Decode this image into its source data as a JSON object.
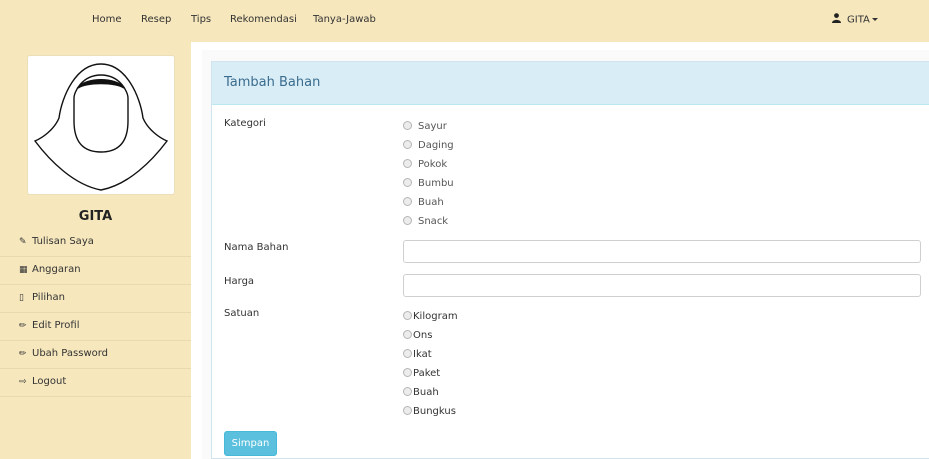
{
  "nav": {
    "links": [
      "Home",
      "Resep",
      "Tips",
      "Rekomendasi",
      "Tanya-Jawab"
    ],
    "user": "GITA"
  },
  "sidebar": {
    "name": "GITA",
    "menu": [
      {
        "label": "Tulisan Saya",
        "icon": "edit-icon"
      },
      {
        "label": "Anggaran",
        "icon": "calculator-icon"
      },
      {
        "label": "Pilihan",
        "icon": "bookmark-icon"
      },
      {
        "label": "Edit Profil",
        "icon": "pencil-icon"
      },
      {
        "label": "Ubah Password",
        "icon": "pencil-icon"
      },
      {
        "label": "Logout",
        "icon": "logout-icon"
      }
    ]
  },
  "form": {
    "title": "Tambah Bahan",
    "kategori_label": "Kategori",
    "kategori_options": [
      "Sayur",
      "Daging",
      "Pokok",
      "Bumbu",
      "Buah",
      "Snack"
    ],
    "nama_label": "Nama Bahan",
    "nama_value": "",
    "harga_label": "Harga",
    "harga_value": "",
    "satuan_label": "Satuan",
    "satuan_options": [
      "Kilogram",
      "Ons",
      "Ikat",
      "Paket",
      "Buah",
      "Bungkus"
    ],
    "submit_label": "Simpan"
  },
  "colors": {
    "navbar_bg": "#f6e7bd",
    "panel_heading_bg": "#d9edf7",
    "button_bg": "#5bc0de"
  }
}
